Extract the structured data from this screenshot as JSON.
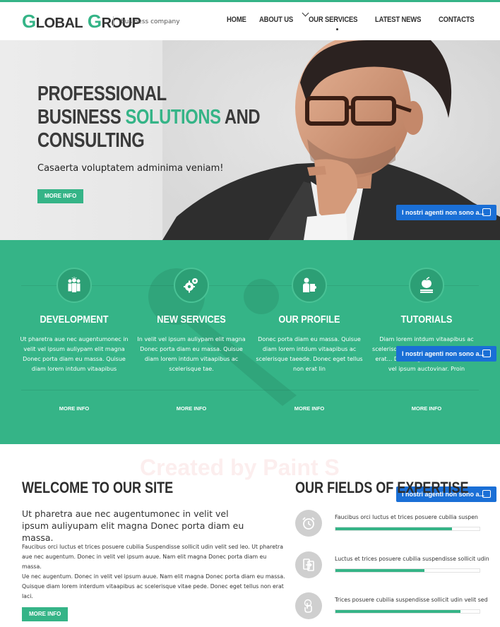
{
  "header": {
    "logo_first_letter": "G",
    "logo_first_rest": "LOBAL",
    "logo_second_letter": "G",
    "logo_second_rest": "ROUP",
    "tagline": "business company",
    "nav": [
      "HOME",
      "ABOUT US",
      "OUR SERVICES",
      "LATEST NEWS",
      "CONTACTS"
    ]
  },
  "hero": {
    "title_line1": "PROFESSIONAL",
    "title_line2_a": "BUSINESS ",
    "title_line2_b": "SOLUTIONS",
    "title_line2_c": " AND",
    "title_line3": "CONSULTING",
    "subtitle": "Casaerta voluptatem adminima veniam!",
    "button": "MORE INFO"
  },
  "chat": {
    "label": "I nostri agenti non sono a..."
  },
  "services": [
    {
      "title": "DEVELOPMENT",
      "icon": "team-icon",
      "text": "Ut pharetra aue nec augentumonec in velit vel ipsum auliypam elit magna Donec porta diam eu massa. Quisue diam lorem intdum vitaapibus",
      "more": "MORE INFO"
    },
    {
      "title": "NEW SERVICES",
      "icon": "gears-icon",
      "text": "In velit vel ipsum auliypam elit magna Donec porta diam eu massa. Quisue diam lorem intdum vitaapibus ac scelerisque tae.",
      "more": "MORE INFO"
    },
    {
      "title": "OUR PROFILE",
      "icon": "profile-puzzle-icon",
      "text": "Donec porta diam eu massa. Quisue diam lorem intdum vitaapibus ac scelerisque taeede. Donec eget tellus non erat lin",
      "more": "MORE INFO"
    },
    {
      "title": "TUTORIALS",
      "icon": "apple-book-icon",
      "text": "Diam lorem intdum vitaapibus ac scelerisque tae. Donec eget tellus non erat... Donec eget tellus non erat lin vel ipsum auctovinar. Proin",
      "more": "MORE INFO"
    }
  ],
  "watermark": "Created by Paint S",
  "welcome": {
    "title": "WELCOME TO OUR SITE",
    "lead": "Ut pharetra aue nec augentumonec in velit vel ipsum auliyupam elit magna Donec porta diam eu massa.",
    "p1": "Faucibus orci luctus et trices posuere cubilia Suspendisse sollicit udin velit sed leo. Ut pharetra aue nec augentum. Donec in velit vel ipsum auue. Nam elit magna Donec porta diam eu massa.",
    "p2": "Ue nec augentum. Donec in velit vel ipsum auue. Nam elit magna Donec porta diam eu massa. Quisque diam lorem interdum vitaapibus ac scelerisque vitae pede. Donec eget tellus non erat laci.",
    "button": "MORE INFO"
  },
  "fields": {
    "title": "OUR FIELDS OF EXPERTISE",
    "items": [
      {
        "label": "Faucibus orci luctus et trices posuere cubilia suspen",
        "icon": "alarm-clock-icon",
        "value": 0.81
      },
      {
        "label": "Luctus et trices posuere cubilia suspendisse sollicit udin",
        "icon": "transfer-icon",
        "value": 0.62
      },
      {
        "label": "Trices posuere cubilia suspendisse sollicit udin velit sed",
        "icon": "touch-hand-icon",
        "value": 0.87
      }
    ]
  }
}
